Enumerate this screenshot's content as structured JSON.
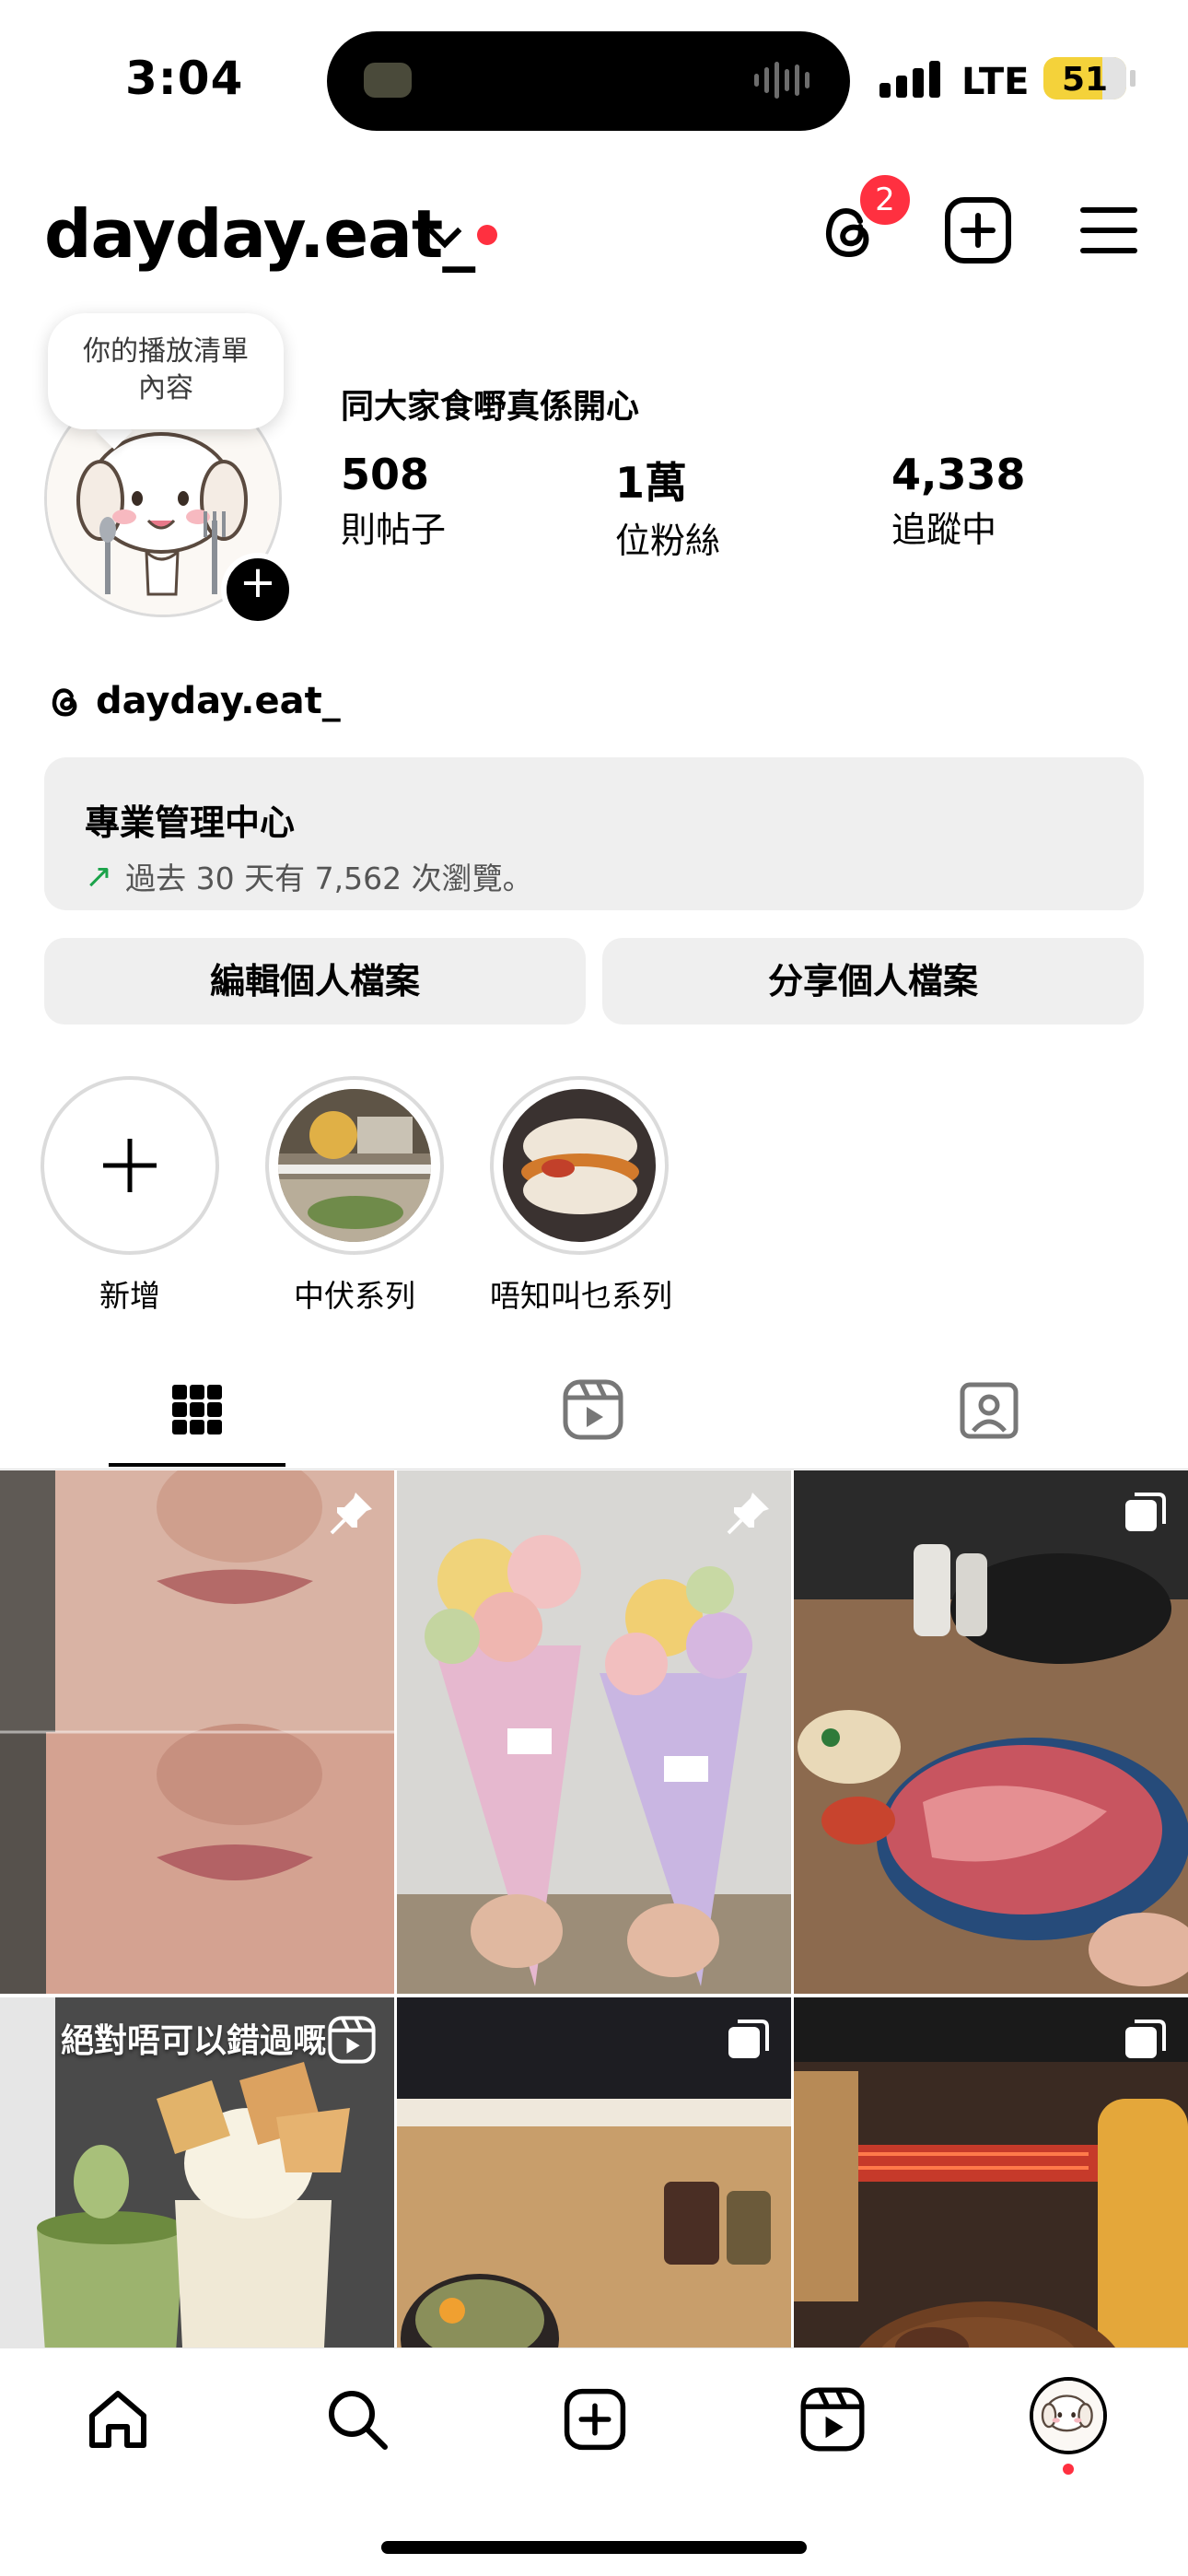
{
  "status_bar": {
    "time": "3:04",
    "network": "LTE",
    "battery": "51",
    "battery_level": 0.51,
    "battery_color": "#f4d23a"
  },
  "header": {
    "username": "dayday.eat_",
    "threads_badge": "2",
    "icons": [
      "chevron-down-icon",
      "threads-icon",
      "create-icon",
      "hamburger-menu-icon"
    ]
  },
  "profile": {
    "tooltip": "你的播放清單\n內容",
    "display_name": "同大家食嘢真係開心",
    "stats": [
      {
        "value": "508",
        "label": "則帖子"
      },
      {
        "value": "1萬",
        "label": "位粉絲"
      },
      {
        "value": "4,338",
        "label": "追蹤中"
      }
    ],
    "threads_handle": "dayday.eat_"
  },
  "dashboard": {
    "title": "專業管理中心",
    "subtitle": "過去 30 天有 7,562 次瀏覽。",
    "arrow_color": "#1ba34a"
  },
  "buttons": {
    "edit": "編輯個人檔案",
    "share": "分享個人檔案"
  },
  "highlights": [
    {
      "label": "新增"
    },
    {
      "label": "中伏系列"
    },
    {
      "label": "唔知叫乜系列"
    }
  ],
  "tabs": [
    "grid-icon",
    "reels-icon",
    "tagged-icon"
  ],
  "posts": [
    {
      "type": "pinned",
      "icon": "pin-icon"
    },
    {
      "type": "pinned",
      "icon": "pin-icon"
    },
    {
      "type": "carousel",
      "icon": "carousel-icon"
    },
    {
      "type": "reel",
      "icon": "reels-icon",
      "title": "絕對唔可以錯過嘅"
    },
    {
      "type": "carousel",
      "icon": "carousel-icon"
    },
    {
      "type": "carousel",
      "icon": "carousel-icon"
    }
  ],
  "bottom_nav": [
    "home-icon",
    "search-icon",
    "create-icon",
    "reels-icon",
    "profile-avatar"
  ],
  "colors": {
    "accent_red": "#ff3040",
    "button_bg": "#efefef"
  }
}
